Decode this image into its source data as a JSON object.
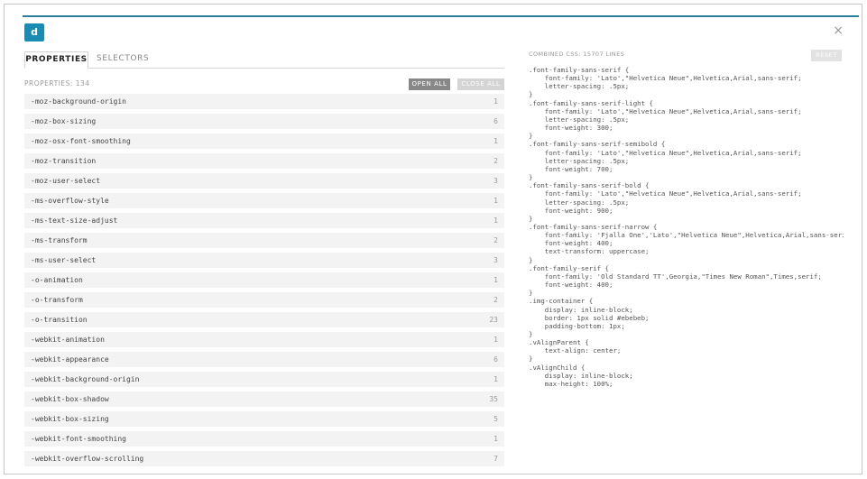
{
  "dialog": {
    "close_glyph": "×",
    "logo_letter": "d",
    "accent_color": "#2a7f9e",
    "logo_color": "#1b8bb4"
  },
  "tabs": [
    {
      "label": "PROPERTIES",
      "active": true
    },
    {
      "label": "SELECTORS",
      "active": false
    }
  ],
  "properties": {
    "count_label": "PROPERTIES: 134",
    "open_all_label": "OPEN ALL",
    "close_all_label": "CLOSE ALL",
    "items": [
      {
        "name": "-moz-background-origin",
        "count": "1"
      },
      {
        "name": "-moz-box-sizing",
        "count": "6"
      },
      {
        "name": "-moz-osx-font-smoothing",
        "count": "1"
      },
      {
        "name": "-moz-transition",
        "count": "2"
      },
      {
        "name": "-moz-user-select",
        "count": "3"
      },
      {
        "name": "-ms-overflow-style",
        "count": "1"
      },
      {
        "name": "-ms-text-size-adjust",
        "count": "1"
      },
      {
        "name": "-ms-transform",
        "count": "2"
      },
      {
        "name": "-ms-user-select",
        "count": "3"
      },
      {
        "name": "-o-animation",
        "count": "1"
      },
      {
        "name": "-o-transform",
        "count": "2"
      },
      {
        "name": "-o-transition",
        "count": "23"
      },
      {
        "name": "-webkit-animation",
        "count": "1"
      },
      {
        "name": "-webkit-appearance",
        "count": "6"
      },
      {
        "name": "-webkit-background-origin",
        "count": "1"
      },
      {
        "name": "-webkit-box-shadow",
        "count": "35"
      },
      {
        "name": "-webkit-box-sizing",
        "count": "5"
      },
      {
        "name": "-webkit-font-smoothing",
        "count": "1"
      },
      {
        "name": "-webkit-overflow-scrolling",
        "count": "7"
      }
    ]
  },
  "combined": {
    "label": "COMBINED CSS: 15707 LINES",
    "reset_label": "RESET",
    "css_text": ".font-family-sans-serif {\n    font-family: 'Lato',\"Helvetica Neue\",Helvetica,Arial,sans-serif;\n    letter-spacing: .5px;\n}\n.font-family-sans-serif-light {\n    font-family: 'Lato',\"Helvetica Neue\",Helvetica,Arial,sans-serif;\n    letter-spacing: .5px;\n    font-weight: 300;\n}\n.font-family-sans-serif-semibold {\n    font-family: 'Lato',\"Helvetica Neue\",Helvetica,Arial,sans-serif;\n    letter-spacing: .5px;\n    font-weight: 700;\n}\n.font-family-sans-serif-bold {\n    font-family: 'Lato',\"Helvetica Neue\",Helvetica,Arial,sans-serif;\n    letter-spacing: .5px;\n    font-weight: 900;\n}\n.font-family-sans-serif-narrow {\n    font-family: 'Fjalla One','Lato',\"Helvetica Neue\",Helvetica,Arial,sans-serif;\n    font-weight: 400;\n    text-transform: uppercase;\n}\n.font-family-serif {\n    font-family: 'Old Standard TT',Georgia,\"Times New Roman\",Times,serif;\n    font-weight: 400;\n}\n.img-container {\n    display: inline-block;\n    border: 1px solid #ebebeb;\n    padding-bottom: 1px;\n}\n.vAlignParent {\n    text-align: center;\n}\n.vAlignChild {\n    display: inline-block;\n    max-height: 100%;"
  }
}
